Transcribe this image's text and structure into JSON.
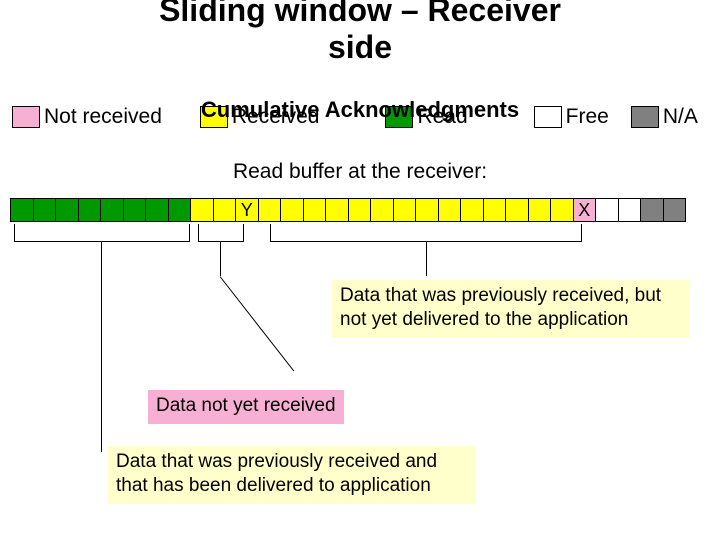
{
  "title_line1": "Sliding window – Receiver",
  "title_line2": "side",
  "subtitle": "Cumulative Acknowledgments",
  "legend": {
    "not_received": "Not received",
    "received": "Received",
    "read": "Read",
    "free": "Free",
    "na": "N/A"
  },
  "buffer_caption": "Read buffer at the receiver:",
  "cells": [
    {
      "c": "green"
    },
    {
      "c": "green"
    },
    {
      "c": "green"
    },
    {
      "c": "green"
    },
    {
      "c": "green"
    },
    {
      "c": "green"
    },
    {
      "c": "green"
    },
    {
      "c": "green"
    },
    {
      "c": "yellow"
    },
    {
      "c": "yellow"
    },
    {
      "c": "yellow",
      "t": "Y"
    },
    {
      "c": "yellow"
    },
    {
      "c": "yellow"
    },
    {
      "c": "yellow"
    },
    {
      "c": "yellow"
    },
    {
      "c": "yellow"
    },
    {
      "c": "yellow"
    },
    {
      "c": "yellow"
    },
    {
      "c": "yellow"
    },
    {
      "c": "yellow"
    },
    {
      "c": "yellow"
    },
    {
      "c": "yellow"
    },
    {
      "c": "yellow"
    },
    {
      "c": "yellow"
    },
    {
      "c": "yellow"
    },
    {
      "c": "pink",
      "t": "X"
    },
    {
      "c": "white"
    },
    {
      "c": "white"
    },
    {
      "c": "gray"
    },
    {
      "c": "gray"
    }
  ],
  "notes": {
    "prev_received_not_delivered": "Data that was previously received, but not yet delivered to the application",
    "not_yet_received": "Data not yet received",
    "prev_received_delivered": "Data that was previously received and that has been delivered to application"
  }
}
